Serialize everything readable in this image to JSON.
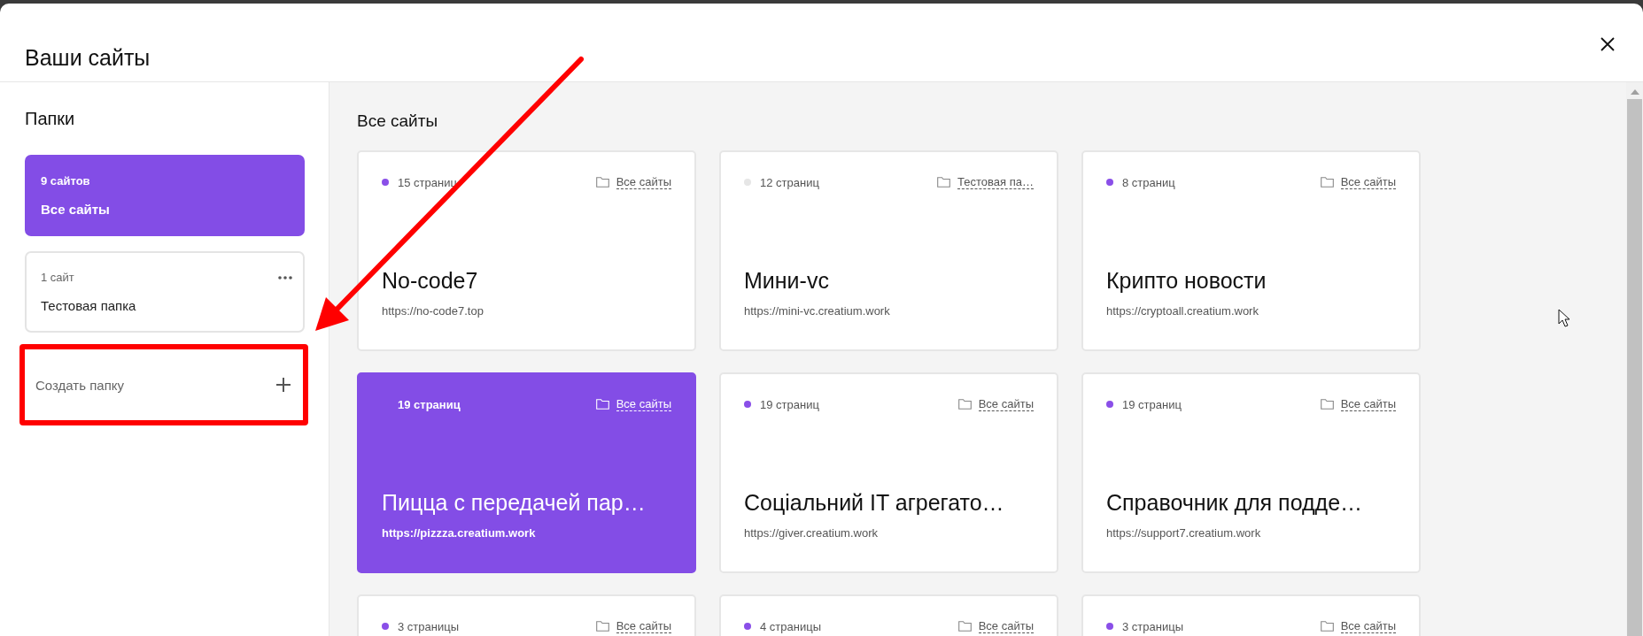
{
  "window": {
    "title": "Ваши сайты"
  },
  "sidebar": {
    "heading": "Папки",
    "folders": [
      {
        "count": "9 сайтов",
        "name": "Все сайты",
        "selected": true,
        "menu": false
      },
      {
        "count": "1 сайт",
        "name": "Тестовая папка",
        "selected": false,
        "menu": true
      }
    ],
    "create_folder": {
      "label": "Создать папку",
      "highlighted": true
    }
  },
  "main": {
    "heading": "Все сайты",
    "sites": [
      {
        "pages": "15 страниц",
        "color": "#8a4fe8",
        "folder": "Все сайты",
        "name": "No-code7",
        "url": "https://no-code7.top",
        "selected": false
      },
      {
        "pages": "12 страниц",
        "color": "#e6e6e6",
        "folder": "Тестовая па…",
        "name": "Мини-vc",
        "url": "https://mini-vc.creatium.work",
        "selected": false
      },
      {
        "pages": "8 страниц",
        "color": "#8a4fe8",
        "folder": "Все сайты",
        "name": "Крипто новости",
        "url": "https://cryptoall.creatium.work",
        "selected": false
      },
      {
        "pages": "19 страниц",
        "folder": "Все сайты",
        "name": "Пицца с передачей пар…",
        "url": "https://pizzza.creatium.work",
        "selected": true
      },
      {
        "pages": "19 страниц",
        "color": "#8a4fe8",
        "folder": "Все сайты",
        "name": "Соціальний IT агрегато…",
        "url": "https://giver.creatium.work",
        "selected": false
      },
      {
        "pages": "19 страниц",
        "color": "#8a4fe8",
        "folder": "Все сайты",
        "name": "Справочник для подде…",
        "url": "https://support7.creatium.work",
        "selected": false
      },
      {
        "pages": "3 страницы",
        "color": "#8a4fe8",
        "folder": "Все сайты",
        "selected": false
      },
      {
        "pages": "4 страницы",
        "color": "#8a4fe8",
        "folder": "Все сайты",
        "selected": false
      },
      {
        "pages": "3 страницы",
        "color": "#8a4fe8",
        "folder": "Все сайты",
        "selected": false
      }
    ]
  },
  "annotations": {
    "arrow": true
  }
}
